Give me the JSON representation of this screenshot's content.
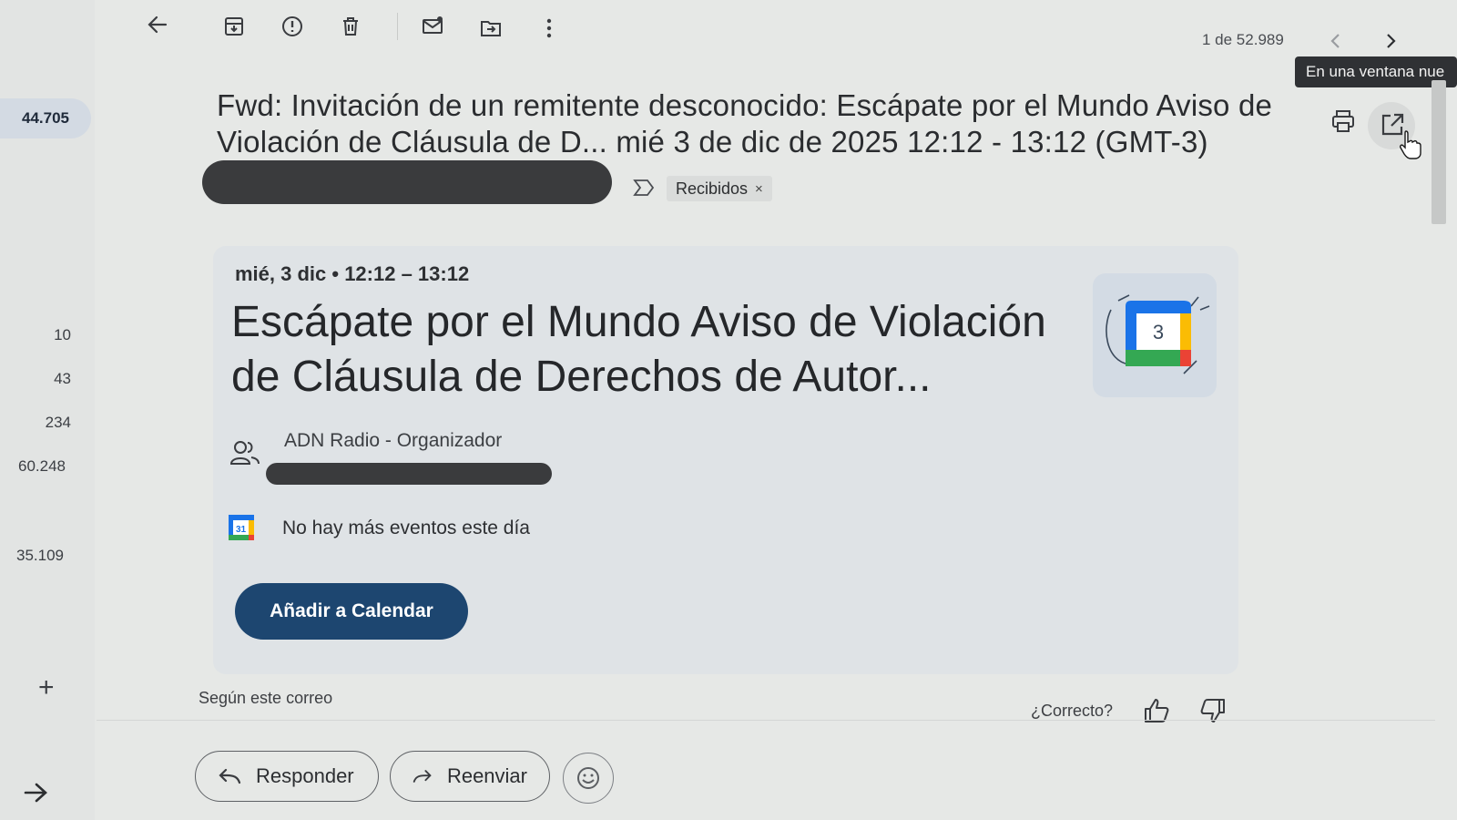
{
  "toolbar": {
    "icons": [
      "back-arrow-icon",
      "archive-icon",
      "report-spam-icon",
      "delete-icon",
      "mark-unread-icon",
      "move-to-icon",
      "more-vert-icon"
    ]
  },
  "pager": {
    "text": "1 de 52.989",
    "tooltip": "En una ventana nue"
  },
  "sidebar": {
    "badge": "44.705",
    "counts": [
      "10",
      "43",
      "234",
      "60.248",
      "35.109"
    ],
    "add_label": "+"
  },
  "email": {
    "subject": "Fwd: Invitación de un remitente desconocido: Escápate por el Mundo Aviso de Violación de Cláusula de D... mié 3 de dic de 2025 12:12 - 13:12 (GMT-3)",
    "label": "Recibidos",
    "label_remove": "×"
  },
  "event_card": {
    "time": "mié, 3 dic • 12:12 – 13:12",
    "title": "Escápate por el Mundo Aviso de Violación de Cláusula de Derechos de Autor...",
    "calendar_art_day": "3",
    "organizer": "ADN Radio - Organizador",
    "mini_calendar_day": "31",
    "no_events": "No hay más eventos este día",
    "add_button": "Añadir a Calendar"
  },
  "feedback": {
    "source": "Según este correo",
    "question": "¿Correcto?"
  },
  "actions": {
    "reply": "Responder",
    "forward": "Reenviar"
  },
  "colors": {
    "primary_button": "#1d4670",
    "background": "#e6e8e6",
    "card": "#dfe3e6"
  }
}
